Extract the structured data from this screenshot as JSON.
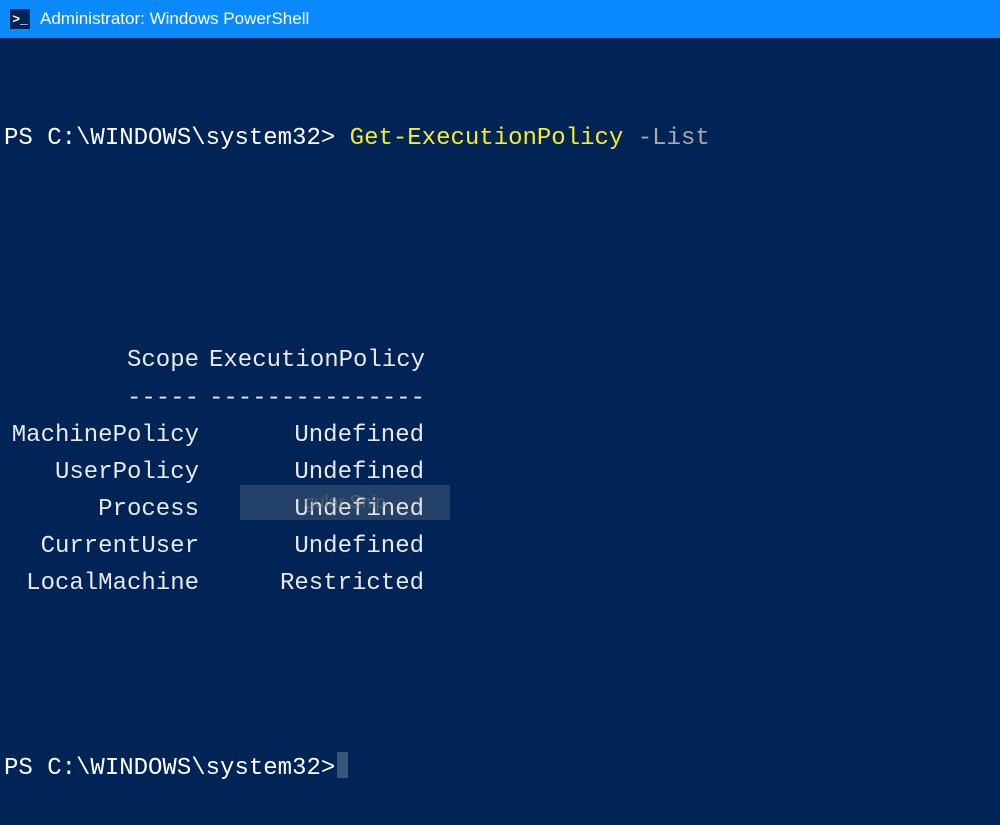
{
  "titlebar": {
    "icon_glyph": ">_",
    "title": "Administrator: Windows PowerShell"
  },
  "prompt1": {
    "prefix": "PS C:\\WINDOWS\\system32>",
    "cmdlet": "Get-ExecutionPolicy",
    "parameter": "-List"
  },
  "output": {
    "header_scope": "Scope",
    "header_policy": "ExecutionPolicy",
    "divider_scope": "-----",
    "divider_policy": "---------------",
    "rows": [
      {
        "scope": "MachinePolicy",
        "policy": "Undefined"
      },
      {
        "scope": "UserPolicy",
        "policy": "Undefined"
      },
      {
        "scope": "Process",
        "policy": "Undefined"
      },
      {
        "scope": "CurrentUser",
        "policy": "Undefined"
      },
      {
        "scope": "LocalMachine",
        "policy": "Restricted"
      }
    ]
  },
  "prompt2": {
    "prefix": "PS C:\\WINDOWS\\system32>"
  },
  "overlay": {
    "text": "gular Snip"
  }
}
